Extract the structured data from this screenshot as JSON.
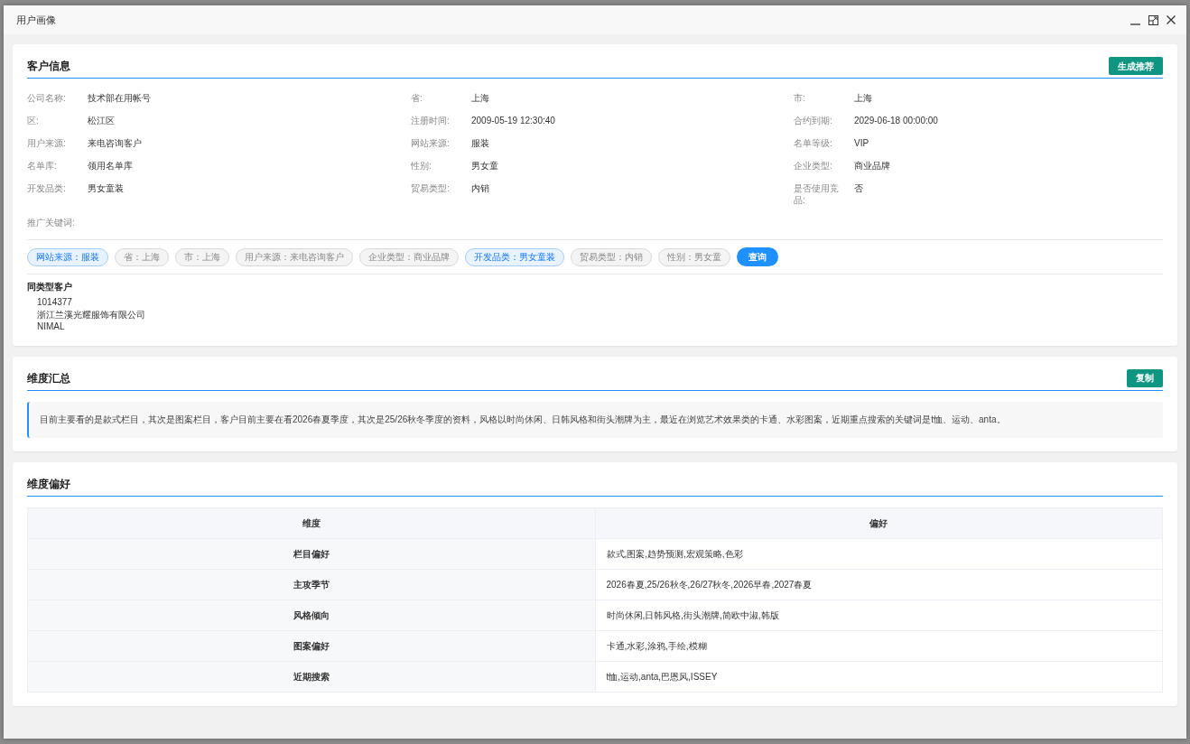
{
  "window": {
    "title": "用户画像"
  },
  "customer_info": {
    "title": "客户信息",
    "button": "生成推荐",
    "fields": [
      {
        "label": "公司名称:",
        "value": "技术部在用帐号"
      },
      {
        "label": "省:",
        "value": "上海"
      },
      {
        "label": "市:",
        "value": "上海"
      },
      {
        "label": "区:",
        "value": "松江区"
      },
      {
        "label": "注册时间:",
        "value": "2009-05-19 12:30:40"
      },
      {
        "label": "合约到期:",
        "value": "2029-06-18 00:00:00"
      },
      {
        "label": "用户来源:",
        "value": "来电咨询客户"
      },
      {
        "label": "网站来源:",
        "value": "服装"
      },
      {
        "label": "名单等级:",
        "value": "VIP"
      },
      {
        "label": "名单库:",
        "value": "领用名单库"
      },
      {
        "label": "性别:",
        "value": "男女童"
      },
      {
        "label": "企业类型:",
        "value": "商业品牌"
      },
      {
        "label": "开发品类:",
        "value": "男女童装"
      },
      {
        "label": "贸易类型:",
        "value": "内销"
      },
      {
        "label": "是否使用竞品:",
        "value": "否"
      },
      {
        "label": "推广关键词:"
      }
    ],
    "tags": [
      {
        "label": "网站来源：服装",
        "selected": true
      },
      {
        "label": "省：上海",
        "selected": false
      },
      {
        "label": "市：上海",
        "selected": false
      },
      {
        "label": "用户来源：来电咨询客户",
        "selected": false
      },
      {
        "label": "企业类型：商业品牌",
        "selected": false
      },
      {
        "label": "开发品类：男女童装",
        "selected": true
      },
      {
        "label": "贸易类型：内销",
        "selected": false
      },
      {
        "label": "性别：男女童",
        "selected": false
      }
    ],
    "query_button": "查询",
    "similar_customers": {
      "title": "同类型客户",
      "items": [
        "1014377",
        "浙江兰溪光耀服饰有限公司",
        "NIMAL"
      ]
    }
  },
  "summary": {
    "title": "维度汇总",
    "button": "复制",
    "text": "目前主要看的是款式栏目，其次是图案栏目，客户目前主要在看2026春夏季度，其次是25/26秋冬季度的资料，风格以时尚休闲、日韩风格和街头潮牌为主，最近在浏览艺术效果类的卡通、水彩图案，近期重点搜索的关键词是t恤、运动、anta。"
  },
  "preferences": {
    "title": "维度偏好",
    "columns": [
      "维度",
      "偏好"
    ],
    "rows": [
      {
        "dimension": "栏目偏好",
        "preference": "款式,图案,趋势预测,宏观策略,色彩"
      },
      {
        "dimension": "主攻季节",
        "preference": "2026春夏,25/26秋冬,26/27秋冬,2026早春,2027春夏"
      },
      {
        "dimension": "风格倾向",
        "preference": "时尚休闲,日韩风格,街头潮牌,简欧中淑,韩版"
      },
      {
        "dimension": "图案偏好",
        "preference": "卡通,水彩,涂鸦,手绘,模糊"
      },
      {
        "dimension": "近期搜索",
        "preference": "t恤,运动,anta,巴恩风,ISSEY"
      }
    ]
  }
}
